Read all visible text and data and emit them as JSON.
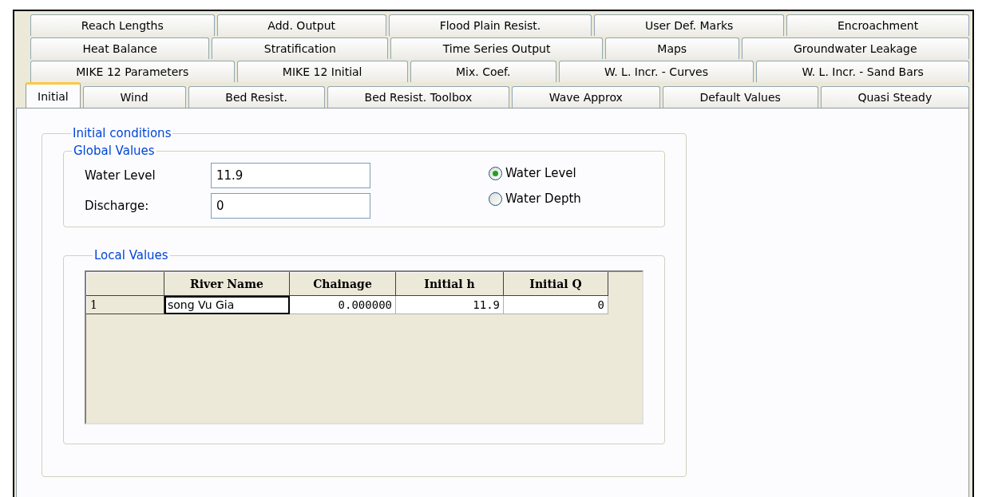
{
  "tab_rows": [
    [
      {
        "label": "Reach Lengths",
        "selected": false
      },
      {
        "label": "Add. Output",
        "selected": false
      },
      {
        "label": "Flood Plain Resist.",
        "selected": false
      },
      {
        "label": "User Def. Marks",
        "selected": false
      },
      {
        "label": "Encroachment",
        "selected": false
      }
    ],
    [
      {
        "label": "Heat Balance",
        "selected": false
      },
      {
        "label": "Stratification",
        "selected": false
      },
      {
        "label": "Time Series Output",
        "selected": false
      },
      {
        "label": "Maps",
        "selected": false
      },
      {
        "label": "Groundwater Leakage",
        "selected": false
      }
    ],
    [
      {
        "label": "MIKE 12 Parameters",
        "selected": false
      },
      {
        "label": "MIKE 12 Initial",
        "selected": false
      },
      {
        "label": "Mix. Coef.",
        "selected": false
      },
      {
        "label": "W. L. Incr. - Curves",
        "selected": false
      },
      {
        "label": "W. L. Incr. - Sand Bars",
        "selected": false
      }
    ],
    [
      {
        "label": "Initial",
        "selected": true
      },
      {
        "label": "Wind",
        "selected": false
      },
      {
        "label": "Bed Resist.",
        "selected": false
      },
      {
        "label": "Bed Resist. Toolbox",
        "selected": false
      },
      {
        "label": "Wave Approx",
        "selected": false
      },
      {
        "label": "Default Values",
        "selected": false
      },
      {
        "label": "Quasi Steady",
        "selected": false
      }
    ]
  ],
  "initial_conditions": {
    "title": "Initial conditions",
    "global_values": {
      "title": "Global Values",
      "fields": [
        {
          "label": "Water Level",
          "value": "11.9"
        },
        {
          "label": "Discharge:",
          "value": "0"
        }
      ],
      "options": [
        {
          "label": "Water Level",
          "selected": true
        },
        {
          "label": "Water Depth",
          "selected": false
        }
      ]
    },
    "local_values": {
      "title": "Local Values",
      "table": {
        "columns": [
          "River Name",
          "Chainage",
          "Initial h",
          "Initial Q"
        ],
        "rows": [
          {
            "header": "1",
            "cells": [
              {
                "text": "song Vu Gia",
                "selected": true
              },
              {
                "text": "0.000000",
                "selected": false
              },
              {
                "text": "11.9",
                "selected": false
              },
              {
                "text": "0",
                "selected": false
              }
            ]
          }
        ]
      }
    }
  }
}
